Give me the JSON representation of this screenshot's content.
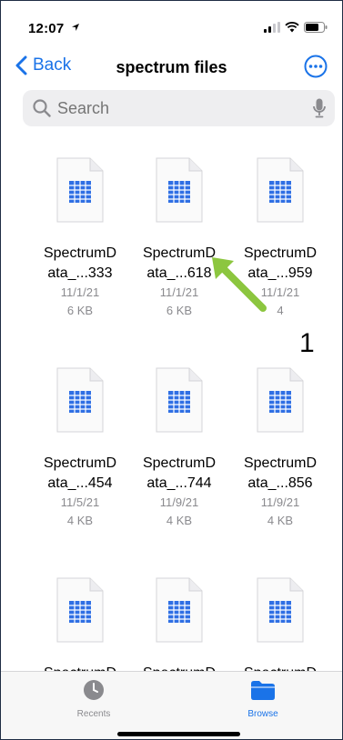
{
  "status_bar": {
    "time": "12:07",
    "location_icon": "location-arrow-icon",
    "signal_icon": "signal-icon",
    "wifi_icon": "wifi-icon",
    "battery_icon": "battery-icon"
  },
  "nav": {
    "back_label": "Back",
    "title": "spectrum files",
    "more_icon": "ellipsis-circle-icon"
  },
  "search": {
    "placeholder": "Search"
  },
  "files": [
    {
      "name_line1": "SpectrumD",
      "name_line2": "ata_...333",
      "date": "11/1/21",
      "size": "6 KB"
    },
    {
      "name_line1": "SpectrumD",
      "name_line2": "ata_...618",
      "date": "11/1/21",
      "size": "6 KB"
    },
    {
      "name_line1": "SpectrumD",
      "name_line2": "ata_...959",
      "date": "11/1/21",
      "size": "4"
    },
    {
      "name_line1": "SpectrumD",
      "name_line2": "ata_...454",
      "date": "11/5/21",
      "size": "4 KB"
    },
    {
      "name_line1": "SpectrumD",
      "name_line2": "ata_...744",
      "date": "11/9/21",
      "size": "4 KB"
    },
    {
      "name_line1": "SpectrumD",
      "name_line2": "ata_...856",
      "date": "11/9/21",
      "size": "4 KB"
    },
    {
      "name_line1": "SpectrumD",
      "name_line2": "",
      "date": "",
      "size": ""
    },
    {
      "name_line1": "SpectrumD",
      "name_line2": "",
      "date": "",
      "size": ""
    },
    {
      "name_line1": "SpectrumD",
      "name_line2": "",
      "date": "",
      "size": ""
    }
  ],
  "annotation": {
    "number": "1",
    "arrow_color": "#8cc63f"
  },
  "tabs": [
    {
      "label": "Recents",
      "icon": "clock-icon",
      "active": false
    },
    {
      "label": "Browse",
      "icon": "folder-icon",
      "active": true
    }
  ],
  "colors": {
    "accent": "#1a73e8",
    "file_icon_blue": "#2f6fe4",
    "inactive_tab": "#8a8a8e"
  }
}
